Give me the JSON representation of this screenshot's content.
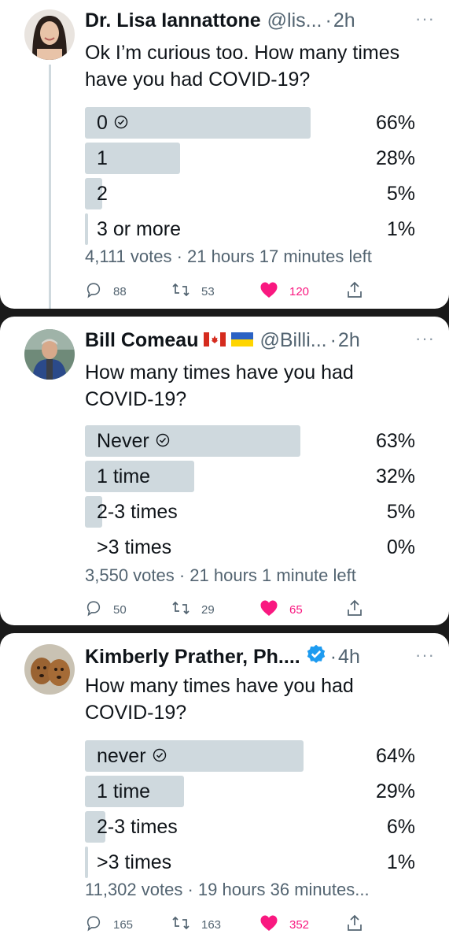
{
  "tweets": [
    {
      "name": "Dr. Lisa Iannattone",
      "handle": "@lis...",
      "time": "2h",
      "text": "Ok I’m curious too. How many times have you had COVID-19?",
      "poll": [
        {
          "label": "0",
          "pct": "66%",
          "winner": true
        },
        {
          "label": "1",
          "pct": "28%"
        },
        {
          "label": "2",
          "pct": "5%"
        },
        {
          "label": "3 or more",
          "pct": "1%"
        }
      ],
      "meta": "4,111 votes · 21 hours 17 minutes left",
      "actions": {
        "replies": "88",
        "retweets": "53",
        "likes": "120"
      }
    },
    {
      "name": "Bill Comeau",
      "handle": "@Billi...",
      "time": "2h",
      "text": "How many times have you had COVID-19?",
      "poll": [
        {
          "label": "Never",
          "pct": "63%",
          "winner": true
        },
        {
          "label": "1 time",
          "pct": "32%"
        },
        {
          "label": "2-3 times",
          "pct": "5%"
        },
        {
          "label": ">3 times",
          "pct": "0%"
        }
      ],
      "meta": "3,550 votes · 21 hours 1 minute left",
      "actions": {
        "replies": "50",
        "retweets": "29",
        "likes": "65"
      }
    },
    {
      "name": "Kimberly Prather, Ph....",
      "time": "4h",
      "text": "How many times have you had COVID-19?",
      "poll": [
        {
          "label": "never",
          "pct": "64%",
          "winner": true
        },
        {
          "label": "1 time",
          "pct": "29%"
        },
        {
          "label": "2-3 times",
          "pct": "6%"
        },
        {
          "label": ">3 times",
          "pct": "1%"
        }
      ],
      "meta": "11,302 votes · 19 hours 36 minutes...",
      "actions": {
        "replies": "165",
        "retweets": "163",
        "likes": "352"
      }
    }
  ],
  "colors": {
    "bar": "#cfd9de",
    "like": "#f91880",
    "verified": "#1d9bf0",
    "muted": "#536471"
  }
}
